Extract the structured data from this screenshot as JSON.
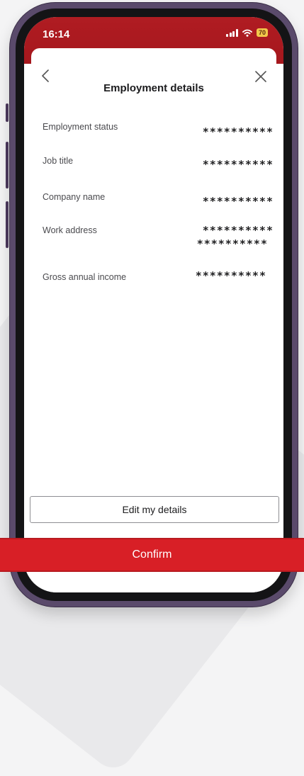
{
  "status_bar": {
    "time": "16:14",
    "battery": "70",
    "bar_color": "#b01c22"
  },
  "sheet": {
    "title": "Employment details",
    "back_icon": "chevron-left-icon",
    "close_icon": "close-icon"
  },
  "fields": [
    {
      "label": "Employment status",
      "value": "**********"
    },
    {
      "label": "Job title",
      "value": "**********"
    },
    {
      "label": "Company name",
      "value": "**********"
    },
    {
      "label": "Work address",
      "value": "**********",
      "value_line2": "**********"
    },
    {
      "label": "Gross annual income",
      "value": "**********"
    }
  ],
  "actions": {
    "edit_label": "Edit my details",
    "confirm_label": "Confirm",
    "confirm_color": "#d81f26"
  }
}
